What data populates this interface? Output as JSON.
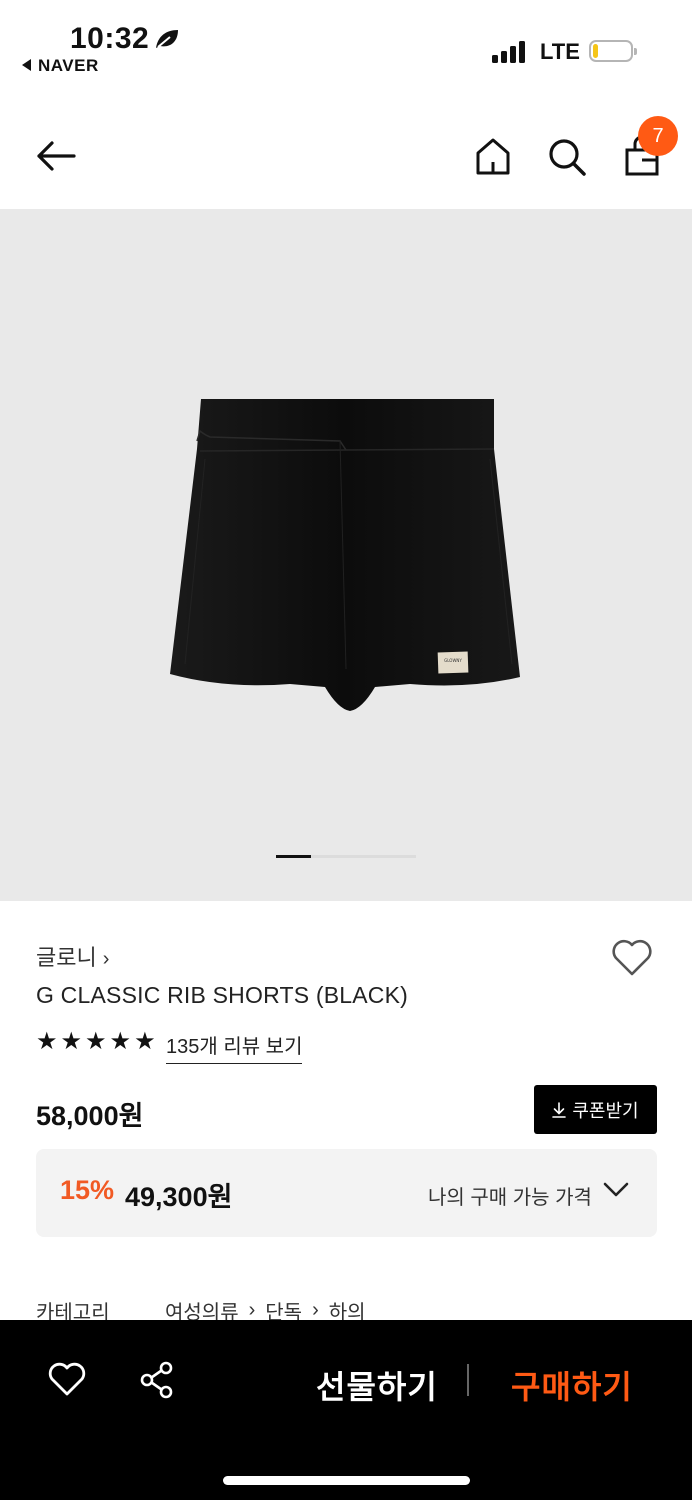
{
  "status_bar": {
    "time": "10:32",
    "back_app": "NAVER",
    "network": "LTE",
    "battery_level": 0.15
  },
  "header": {
    "cart_count": "7"
  },
  "product": {
    "image_index": 1,
    "image_count": 4,
    "label_brand": "GLOWNY",
    "brand": "글로니",
    "title": "G CLASSIC RIB SHORTS (BLACK)",
    "rating_stars": 5,
    "reviews_link": "135개 리뷰 보기",
    "price": "58,000원",
    "coupon_label": "쿠폰받기",
    "discount_rate": "15%",
    "discount_price": "49,300원",
    "my_price_label": "나의 구매 가능 가격"
  },
  "category": {
    "label": "카테고리",
    "path": [
      "여성의류",
      "단독",
      "하의"
    ]
  },
  "bottom_bar": {
    "gift_label": "선물하기",
    "buy_label": "구매하기"
  },
  "colors": {
    "accent": "#ff5a14",
    "discount": "#f15a24",
    "hero_bg": "#e9e9e9"
  }
}
